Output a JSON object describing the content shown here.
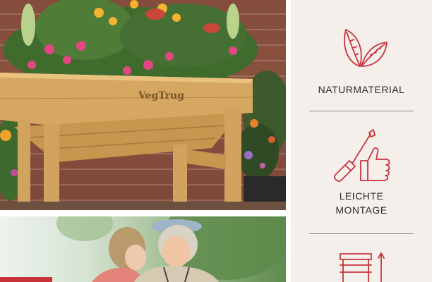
{
  "product": {
    "brand_label": "VegTrug"
  },
  "features": [
    {
      "icon": "leaves-icon",
      "label_line1": "NATURMATERIAL",
      "label_line2": ""
    },
    {
      "icon": "screwdriver-thumbs-up-icon",
      "label_line1": "LEICHTE",
      "label_line2": "MONTAGE"
    },
    {
      "icon": "stool-height-icon",
      "label_line1": "",
      "label_line2": ""
    }
  ],
  "colors": {
    "accent": "#c8333a",
    "panel_bg": "#f5efec",
    "divider": "#8c8c8c",
    "wood": "#d2a35e"
  }
}
